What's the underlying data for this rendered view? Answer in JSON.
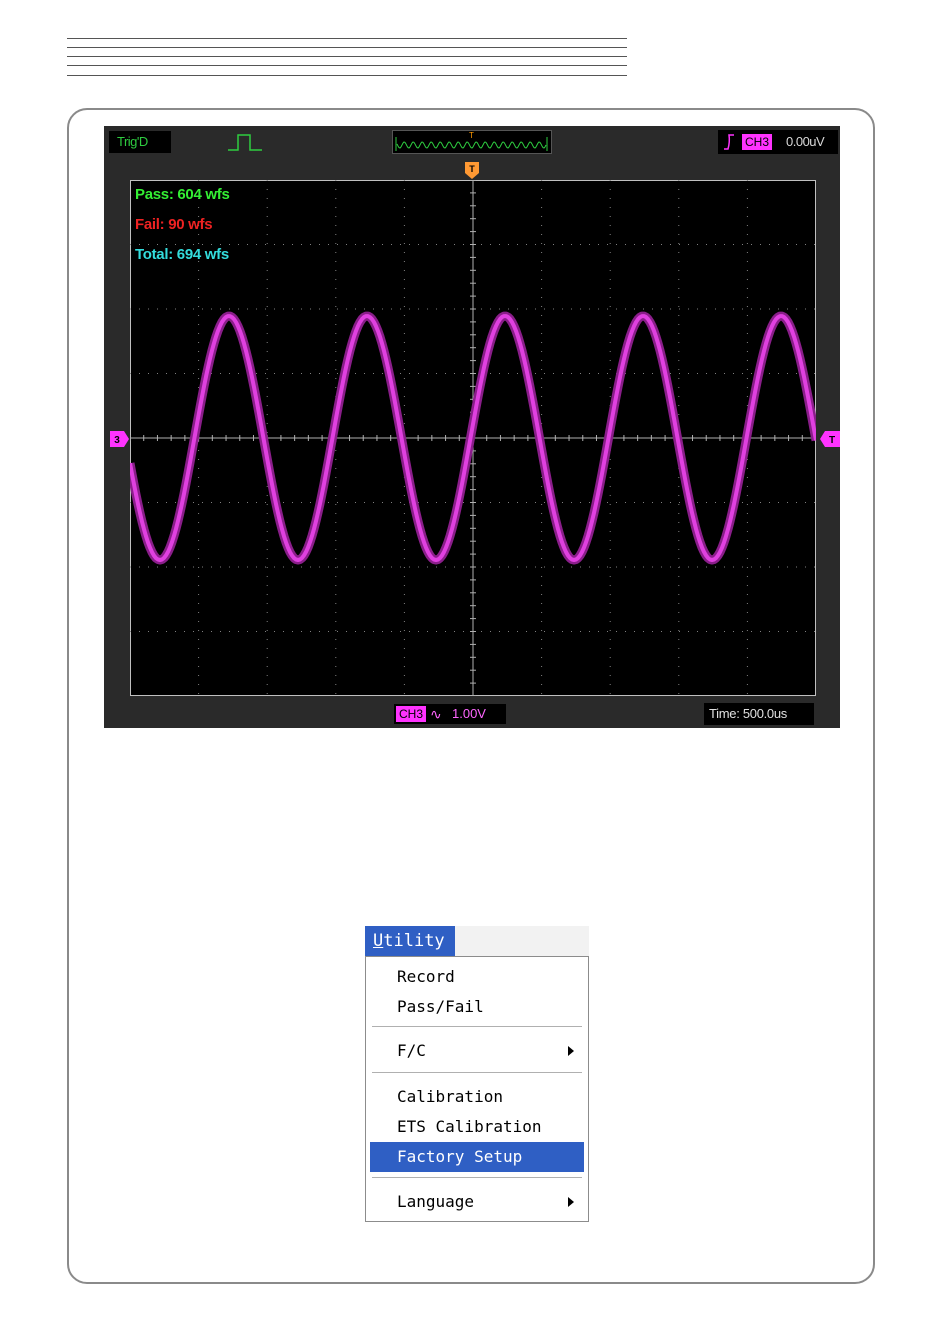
{
  "scope": {
    "trigger_status": "Trig'D",
    "trigger_source": "CH3",
    "trigger_level": "0.00uV",
    "channel": "CH3",
    "coupling_symbol": "∿",
    "volts_div": "1.00V",
    "timebase": "Time: 500.0us",
    "trigger_marker": "T",
    "channel_marker": "3",
    "pass_fail": {
      "pass": "Pass: 604 wfs",
      "fail": "Fail: 90 wfs",
      "total": "Total: 694 wfs"
    },
    "colors": {
      "trace": "#e040e0",
      "grid": "#808080",
      "pass": "#33ee33",
      "fail": "#ee2222",
      "total": "#33dddd"
    },
    "icons": [
      "pulse-icon",
      "rising-edge-icon",
      "waveform-preview-icon"
    ]
  },
  "menu": {
    "title_hotkey": "U",
    "title_rest": "tility",
    "items": [
      {
        "label": "Record"
      },
      {
        "label": "Pass/Fail"
      },
      {
        "label": "F/C"
      },
      {
        "label": "Calibration"
      },
      {
        "label": "ETS Calibration"
      },
      {
        "label": "Factory Setup"
      },
      {
        "label": "Language"
      }
    ],
    "selected": "Factory Setup"
  }
}
